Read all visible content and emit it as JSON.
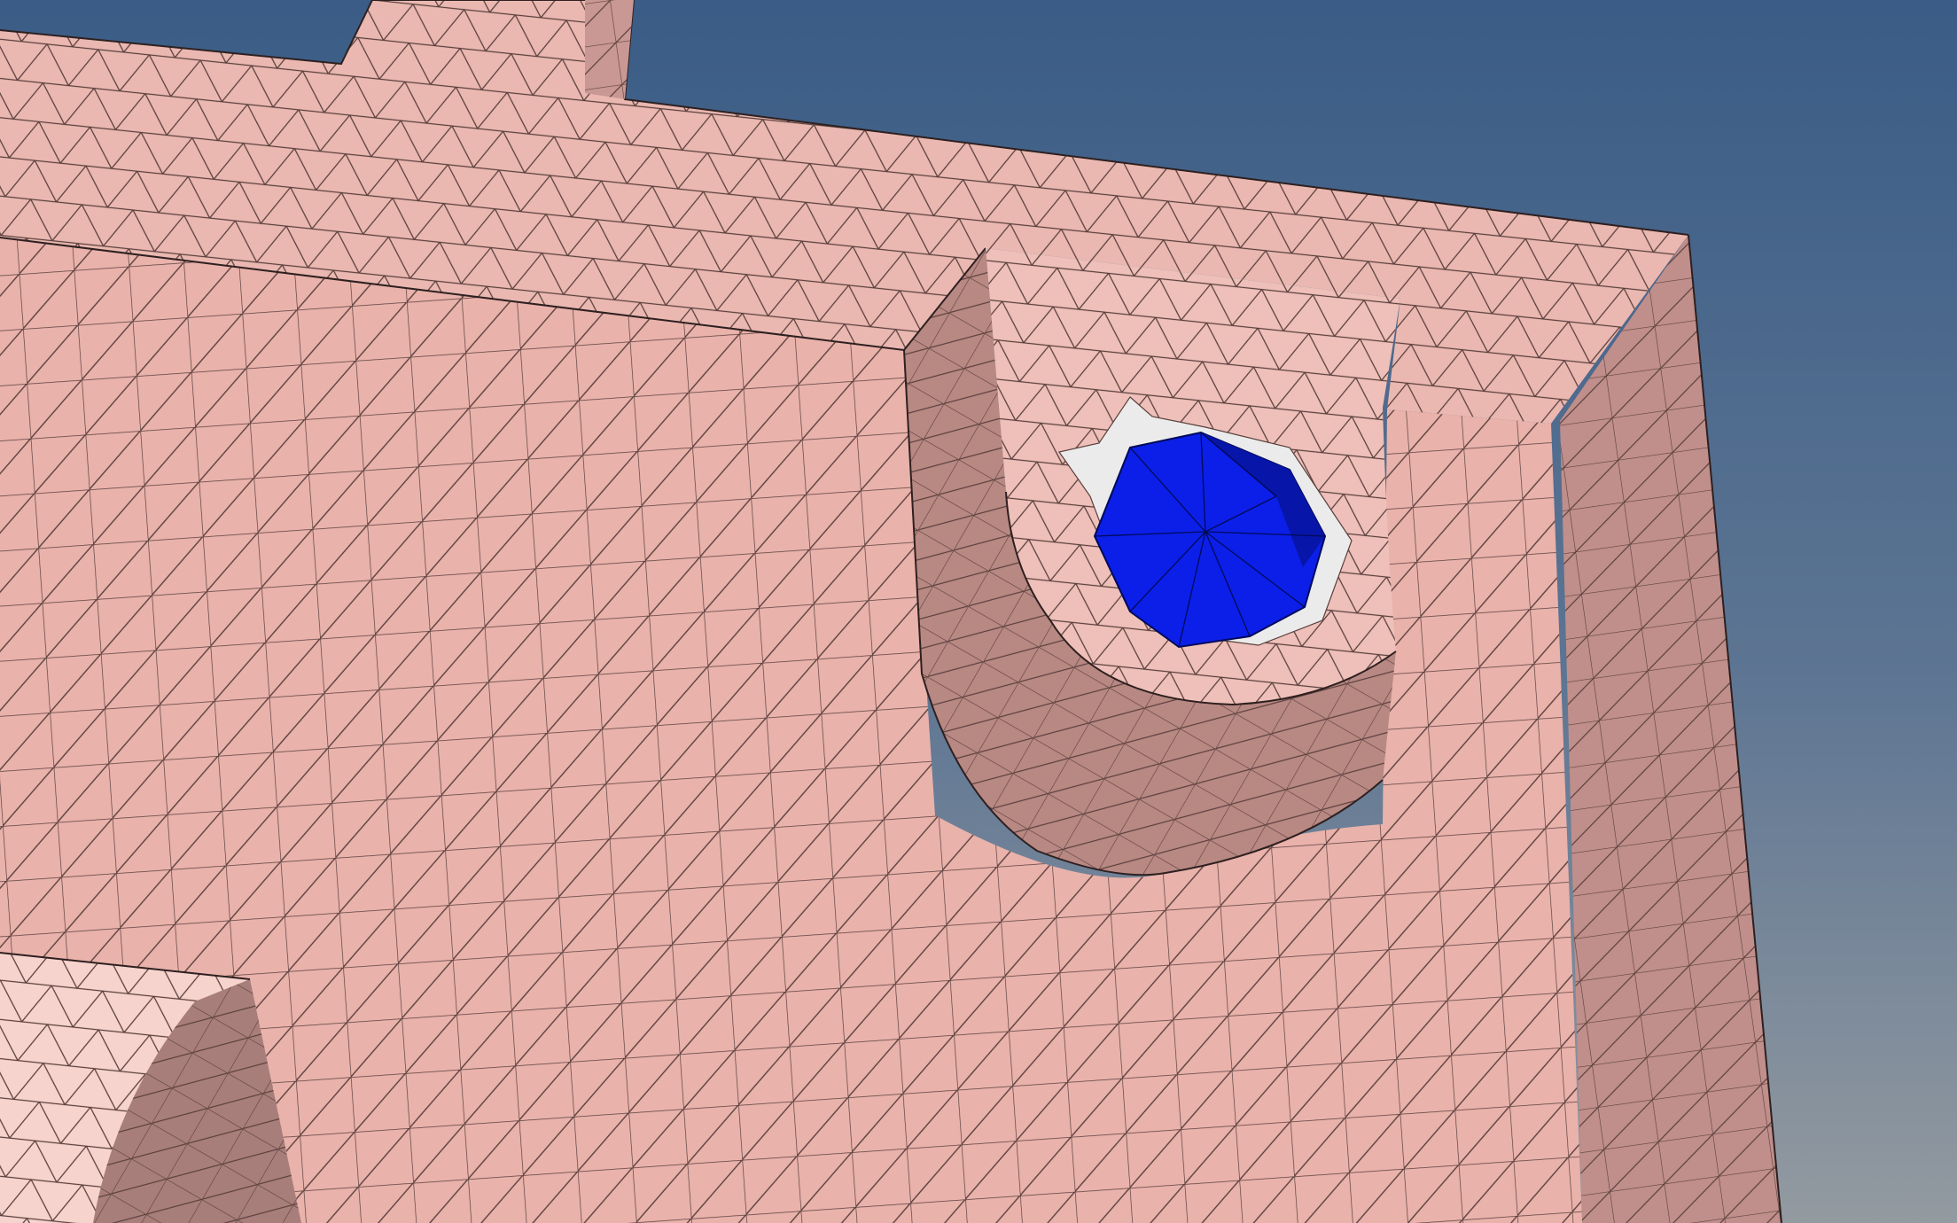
{
  "viewport": {
    "background_top_color": "#3a5c86",
    "background_bottom_color": "#939aa0"
  },
  "model": {
    "part_face_color": "#e9b2ab",
    "part_face_light_color": "#f7d3cd",
    "part_side_color": "#c99894",
    "part_shadow_color": "#a87e7a",
    "mesh_edge_color": "#5a3f3c",
    "outline_color": "#2e2020",
    "hole_clearance_color": "#ebebeb",
    "bolt_color": "#0b1fe8",
    "bolt_dark_color": "#0715a8",
    "bolt_edge_color": "#000a5a"
  }
}
